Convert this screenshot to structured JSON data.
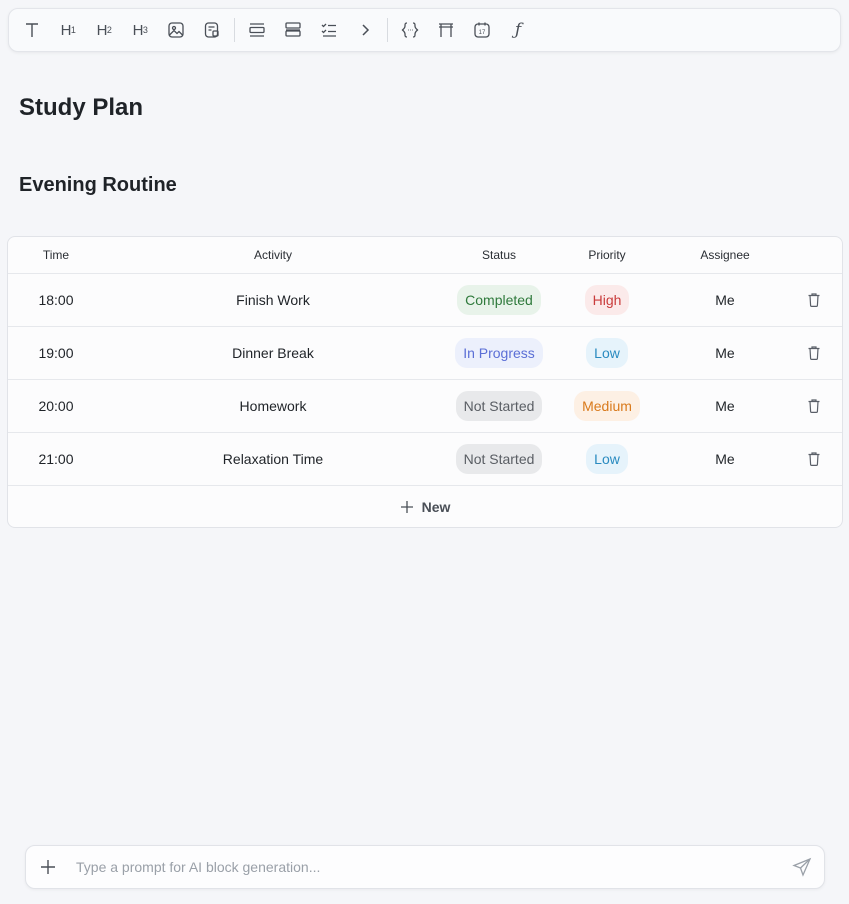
{
  "toolbar": {
    "icons": [
      "text-icon",
      "heading-1-icon",
      "heading-2-icon",
      "heading-3-icon",
      "image-icon",
      "file-image-icon",
      "align-center-list-icon",
      "align-justify-icon",
      "checklist-icon",
      "chevron-right-icon",
      "code-braces-icon",
      "table-icon",
      "calendar-icon",
      "function-icon"
    ],
    "h1": "H",
    "h1_sub": "1",
    "h2": "H",
    "h2_sub": "2",
    "h3": "H",
    "h3_sub": "3",
    "calendar_day": "17",
    "function_glyph": "ƒ"
  },
  "page": {
    "title": "Study Plan",
    "section_title": "Evening Routine"
  },
  "table": {
    "headers": {
      "time": "Time",
      "activity": "Activity",
      "status": "Status",
      "priority": "Priority",
      "assignee": "Assignee"
    },
    "rows": [
      {
        "time": "18:00",
        "activity": "Finish Work",
        "status": "Completed",
        "priority": "High",
        "assignee": "Me"
      },
      {
        "time": "19:00",
        "activity": "Dinner Break",
        "status": "In Progress",
        "priority": "Low",
        "assignee": "Me"
      },
      {
        "time": "20:00",
        "activity": "Homework",
        "status": "Not Started",
        "priority": "Medium",
        "assignee": "Me"
      },
      {
        "time": "21:00",
        "activity": "Relaxation Time",
        "status": "Not Started",
        "priority": "Low",
        "assignee": "Me"
      }
    ],
    "new_label": "New"
  },
  "status_colors": {
    "Completed": {
      "bg": "#e8f3ea",
      "fg": "#2f7a3c"
    },
    "In Progress": {
      "bg": "#ecf0fc",
      "fg": "#5b6fd6"
    },
    "Not Started": {
      "bg": "#e8e9eb",
      "fg": "#5a5e64"
    }
  },
  "priority_colors": {
    "High": {
      "bg": "#fbeaea",
      "fg": "#c93b3b"
    },
    "Low": {
      "bg": "#e6f3fb",
      "fg": "#2a8bc0"
    },
    "Medium": {
      "bg": "#fdf0e4",
      "fg": "#d97a1c"
    }
  },
  "prompt": {
    "placeholder": "Type a prompt for AI block generation...",
    "value": ""
  }
}
